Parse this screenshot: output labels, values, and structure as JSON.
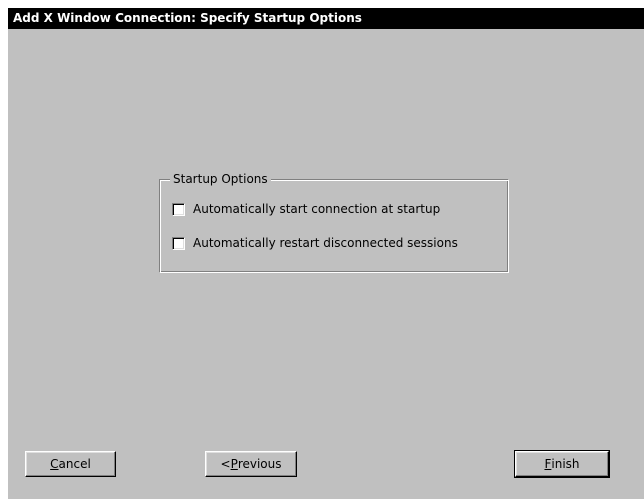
{
  "window": {
    "title": "Add X Window Connection: Specify Startup Options"
  },
  "startup_options": {
    "group_label": "Startup Options",
    "options": [
      {
        "label": "Automatically start connection at startup",
        "checked": false
      },
      {
        "label": "Automatically restart disconnected sessions",
        "checked": false
      }
    ]
  },
  "buttons": {
    "cancel": {
      "mnemonic": "C",
      "rest": "ancel"
    },
    "previous": {
      "prefix": "<",
      "mnemonic": "P",
      "rest": "revious"
    },
    "finish": {
      "mnemonic": "F",
      "rest": "inish"
    }
  },
  "colors": {
    "background": "#c0c0c0",
    "titlebar": "#000000",
    "titlebar_text": "#ffffff"
  }
}
